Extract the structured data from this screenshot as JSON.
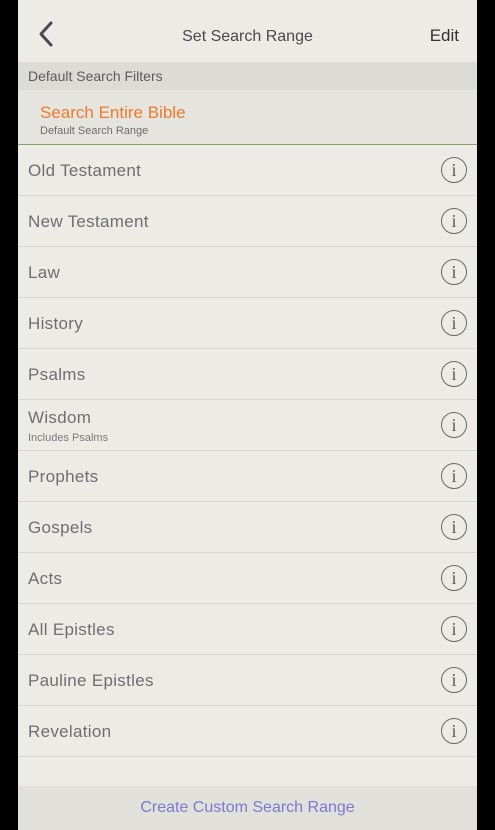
{
  "navbar": {
    "title": "Set Search Range",
    "edit_label": "Edit",
    "back_icon": "chevron-left-icon"
  },
  "section": {
    "header": "Default Search Filters"
  },
  "default_range": {
    "title": "Search Entire Bible",
    "subtitle": "Default Search Range",
    "color": "#ee7a2a"
  },
  "ranges": [
    {
      "label": "Old Testament",
      "sub": ""
    },
    {
      "label": "New Testament",
      "sub": ""
    },
    {
      "label": "Law",
      "sub": ""
    },
    {
      "label": "History",
      "sub": ""
    },
    {
      "label": "Psalms",
      "sub": ""
    },
    {
      "label": "Wisdom",
      "sub": "Includes Psalms"
    },
    {
      "label": "Prophets",
      "sub": ""
    },
    {
      "label": "Gospels",
      "sub": ""
    },
    {
      "label": "Acts",
      "sub": ""
    },
    {
      "label": "All Epistles",
      "sub": ""
    },
    {
      "label": "Pauline Epistles",
      "sub": ""
    },
    {
      "label": "Revelation",
      "sub": ""
    }
  ],
  "info_icon_glyph": "i",
  "footer": {
    "label": "Create Custom Search Range",
    "color": "#7b7ad1"
  }
}
